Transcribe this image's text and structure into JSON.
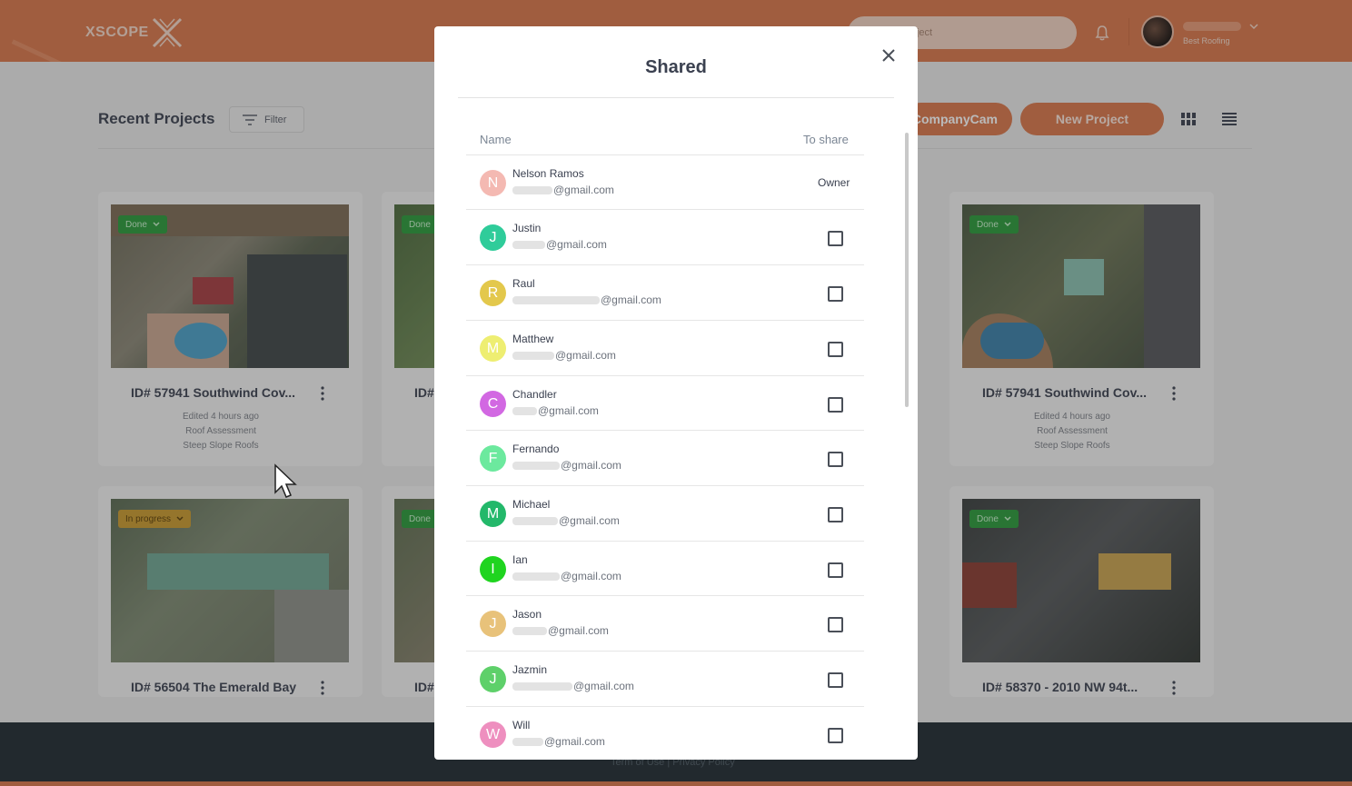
{
  "header": {
    "logo_text": "XSCOPE",
    "search_placeholder": "project",
    "user_company": "Best Roofing"
  },
  "toolbar": {
    "page_title": "Recent Projects",
    "filter_label": "Filter",
    "companycam_label": "CompanyCam",
    "new_project_label": "New Project"
  },
  "cards": [
    {
      "status": "Done",
      "title": "ID# 57941 Southwind Cov...",
      "meta1": "Edited 4 hours ago",
      "meta2": "Roof Assessment",
      "meta3": "Steep Slope Roofs"
    },
    {
      "status": "Done",
      "title": "ID#"
    },
    {
      "status": "Done",
      "title": "ID# 57941 Southwind Cov...",
      "meta1": "Edited 4 hours ago",
      "meta2": "Roof Assessment",
      "meta3": "Steep Slope Roofs"
    },
    {
      "status": "In progress",
      "title": "ID# 56504 The Emerald Bay"
    },
    {
      "status": "Done",
      "title": "ID#"
    },
    {
      "status": "Done",
      "title": "ID# 58370 - 2010 NW 94t..."
    }
  ],
  "footer": {
    "links": "Term of Use | Privacy Policy"
  },
  "modal": {
    "title": "Shared",
    "col_name": "Name",
    "col_share": "To share",
    "owner_label": "Owner",
    "people": [
      {
        "initial": "N",
        "name": "Nelson Ramos",
        "email": "@gmail.com",
        "color": "#f4b9b2"
      },
      {
        "initial": "J",
        "name": "Justin",
        "email": "@gmail.com",
        "color": "#2fcc9a"
      },
      {
        "initial": "R",
        "name": "Raul",
        "email": "@gmail.com",
        "color": "#e3c84c"
      },
      {
        "initial": "M",
        "name": "Matthew",
        "email": "@gmail.com",
        "color": "#eeee72"
      },
      {
        "initial": "C",
        "name": "Chandler",
        "email": "@gmail.com",
        "color": "#d268e2"
      },
      {
        "initial": "F",
        "name": "Fernando",
        "email": "@gmail.com",
        "color": "#6ce99e"
      },
      {
        "initial": "M",
        "name": "Michael",
        "email": "@gmail.com",
        "color": "#23b86a"
      },
      {
        "initial": "I",
        "name": "Ian",
        "email": "@gmail.com",
        "color": "#1fd41f"
      },
      {
        "initial": "J",
        "name": "Jason",
        "email": "@gmail.com",
        "color": "#e8c27a"
      },
      {
        "initial": "J",
        "name": "Jazmin",
        "email": "@gmail.com",
        "color": "#5ed06a"
      },
      {
        "initial": "W",
        "name": "Will",
        "email": "@gmail.com",
        "color": "#ee8fbf"
      }
    ]
  }
}
